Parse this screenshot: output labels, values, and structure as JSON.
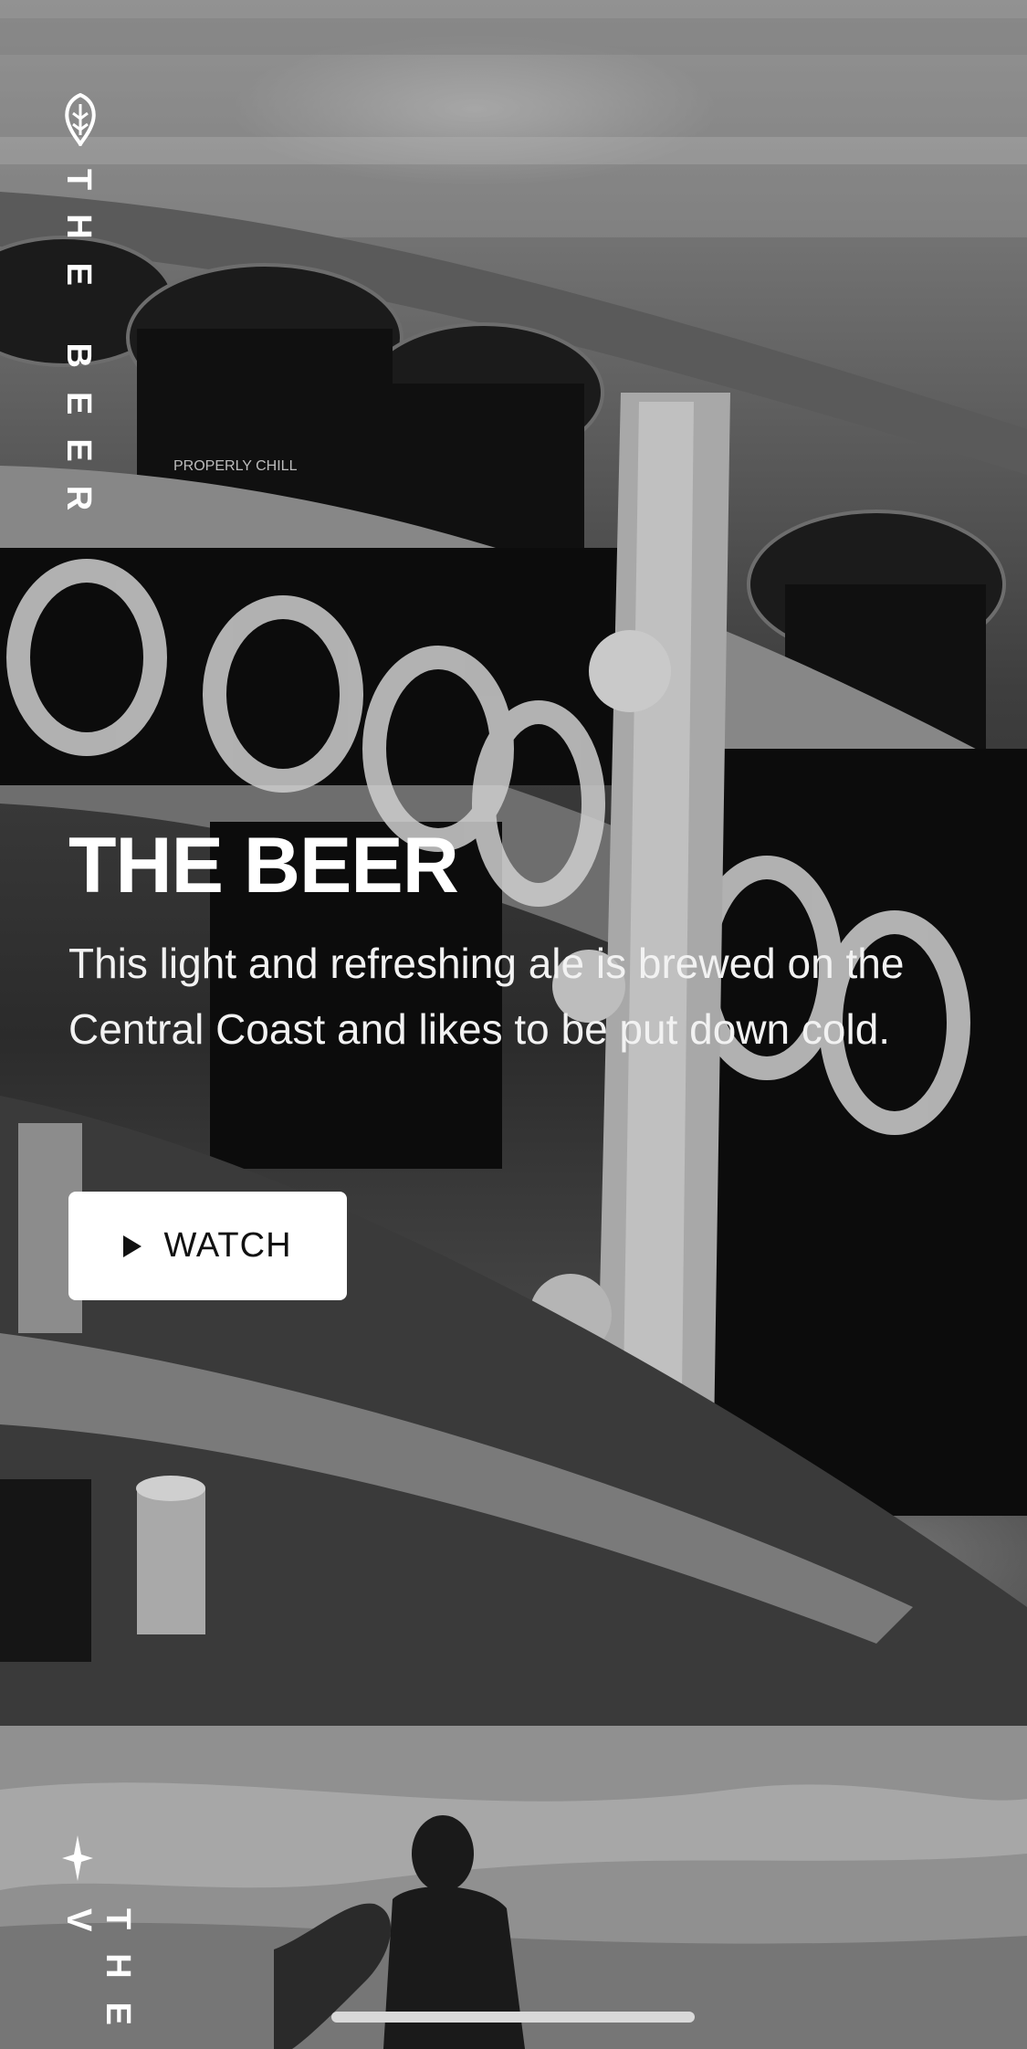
{
  "hero": {
    "side_label": "THE BEER",
    "title": "THE BEER",
    "description": "This light and refreshing ale is brewed on the Central Coast and likes to be put down cold.",
    "watch_label": "WATCH",
    "photo_can_text": "PROPERLY CHILL"
  },
  "section2": {
    "side_label": "THE V"
  },
  "icons": {
    "top": "hop-icon",
    "second": "star-icon",
    "play": "play-icon"
  }
}
